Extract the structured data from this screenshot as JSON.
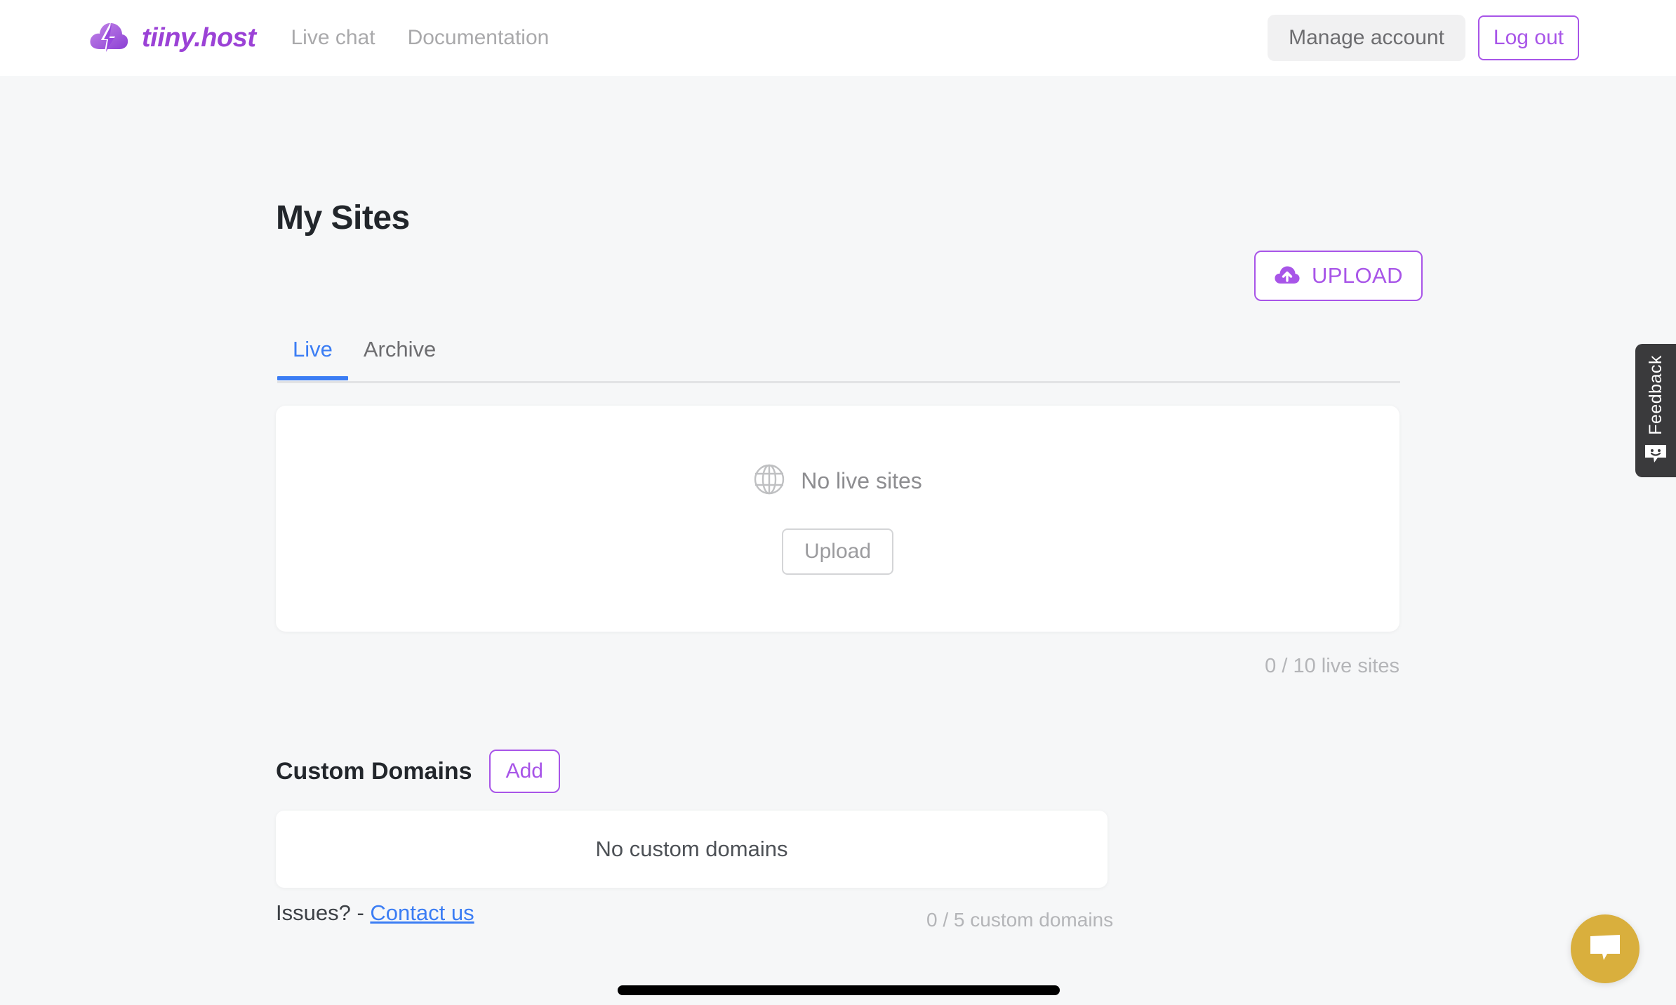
{
  "header": {
    "brand_name": "tiiny.host",
    "logo_icon": "cloud-lightning-icon",
    "nav": [
      {
        "label": "Live chat"
      },
      {
        "label": "Documentation"
      }
    ],
    "manage_account_label": "Manage account",
    "logout_label": "Log out"
  },
  "main": {
    "page_title": "My Sites",
    "upload_button_label": "UPLOAD",
    "upload_icon": "cloud-upload-icon",
    "tabs": [
      {
        "label": "Live",
        "active": true
      },
      {
        "label": "Archive",
        "active": false
      }
    ],
    "sites_empty": {
      "icon": "globe-icon",
      "message": "No live sites",
      "upload_label": "Upload"
    },
    "sites_counter": "0 / 10 live sites"
  },
  "custom_domains": {
    "title": "Custom Domains",
    "add_label": "Add",
    "empty_message": "No custom domains",
    "counter": "0 / 5 custom domains"
  },
  "footer": {
    "issues_prefix": "Issues? - ",
    "contact_label": "Contact us"
  },
  "feedback": {
    "label": "Feedback",
    "icon": "smiley-chat-icon"
  },
  "chat": {
    "icon": "chat-bubble-icon"
  },
  "colors": {
    "brand_purple": "#a855e8",
    "accent_blue": "#3b7df4",
    "chat_gold": "#d9af3d",
    "feedback_dark": "#3a3a3c",
    "page_bg": "#f6f7f8",
    "text_dark": "#22262b",
    "text_muted": "#8d8d90"
  }
}
